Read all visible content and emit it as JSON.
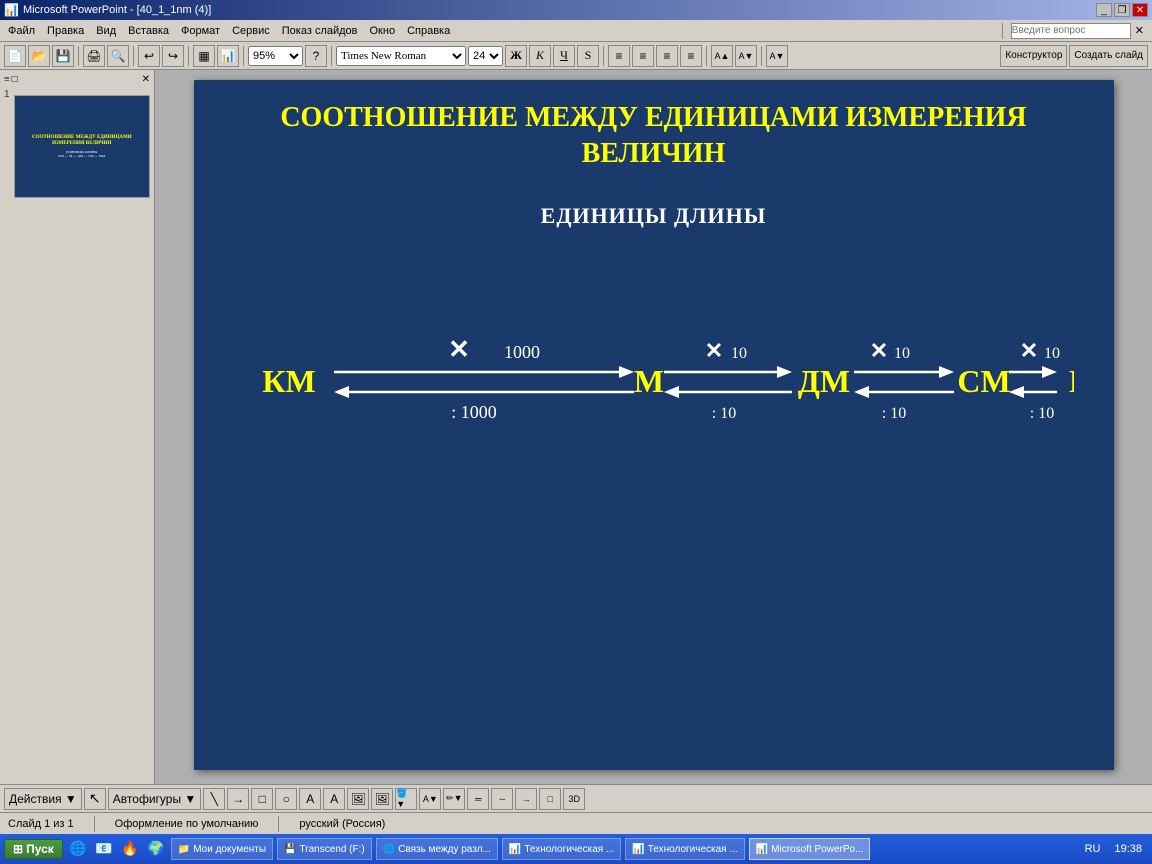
{
  "titlebar": {
    "title": "Microsoft PowerPoint - [40_1_1nm (4)]",
    "icon": "ppt-icon",
    "buttons": [
      "minimize",
      "restore",
      "close"
    ]
  },
  "menu": {
    "items": [
      "Файл",
      "Правка",
      "Вид",
      "Вставка",
      "Формат",
      "Сервис",
      "Показ слайдов",
      "Окно",
      "Справка"
    ]
  },
  "ask": {
    "placeholder": "Введите вопрос"
  },
  "toolbar": {
    "zoom": "95%",
    "font": "Times New Roman",
    "size": "24",
    "buttons": [
      "B",
      "K",
      "Ч",
      "S"
    ],
    "right_buttons": [
      "Конструктор",
      "Создать слайд"
    ]
  },
  "slide": {
    "title": "СООТНОШЕНИЕ МЕЖДУ ЕДИНИЦАМИ ИЗМЕРЕНИЯ ВЕЛИЧИН",
    "subtitle": "ЕДИНИЦЫ ДЛИНЫ",
    "units": [
      "КМ",
      "М",
      "ДМ",
      "СМ",
      "МM"
    ],
    "multipliers": [
      "× 1000",
      "× 10",
      "× 10",
      "× 10"
    ],
    "divisors": [
      ": 1000",
      ": 10",
      ": 10",
      ": 10"
    ]
  },
  "statusbar": {
    "slide_info": "Слайд 1 из 1",
    "design": "Оформление по умолчанию",
    "language": "русский (Россия)"
  },
  "taskbar": {
    "start": "Пуск",
    "items": [
      "Мои документы",
      "Transcend (F:)",
      "Связь между разл...",
      "Технологическая ...",
      "Технологическая ...",
      "Microsoft PowerPo..."
    ],
    "clock": "19:38",
    "lang": "RU"
  }
}
